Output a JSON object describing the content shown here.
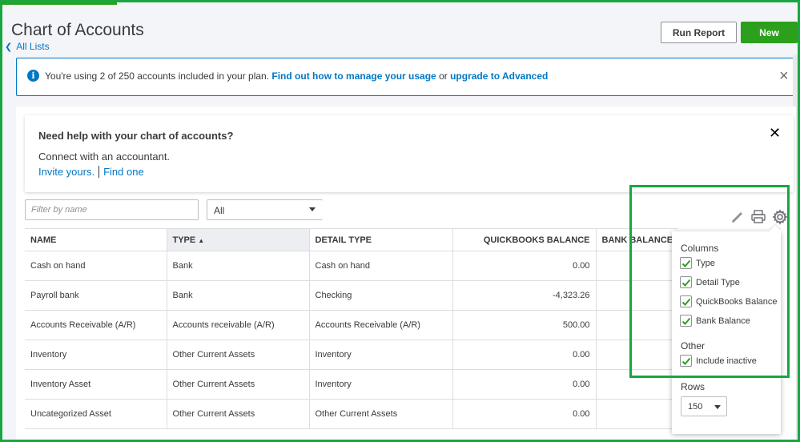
{
  "header": {
    "title": "Chart of Accounts",
    "back_link": "All Lists",
    "run_report_label": "Run Report",
    "new_label": "New"
  },
  "banner": {
    "text": "You're using 2 of 250 accounts included in your plan.",
    "link1": "Find out how to manage your usage",
    "joiner": "or",
    "link2": "upgrade to Advanced",
    "close_symbol": "×"
  },
  "help": {
    "title": "Need help with your chart of accounts?",
    "subtitle": "Connect with an accountant.",
    "link_invite": "Invite yours.",
    "link_find": "Find one",
    "close_symbol": "✕"
  },
  "filters": {
    "name_placeholder": "Filter by name",
    "type_value": "All"
  },
  "table": {
    "columns": {
      "name": "NAME",
      "type": "TYPE",
      "sort_indicator": "▲",
      "detail_type": "DETAIL TYPE",
      "qb_balance": "QUICKBOOKS BALANCE",
      "bank_balance": "BANK BALANCE"
    },
    "rows": [
      {
        "name": "Cash on hand",
        "type": "Bank",
        "detail": "Cash on hand",
        "qb": "0.00"
      },
      {
        "name": "Payroll bank",
        "type": "Bank",
        "detail": "Checking",
        "qb": "-4,323.26"
      },
      {
        "name": "Accounts Receivable (A/R)",
        "type": "Accounts receivable (A/R)",
        "detail": "Accounts Receivable (A/R)",
        "qb": "500.00"
      },
      {
        "name": "Inventory",
        "type": "Other Current Assets",
        "detail": "Inventory",
        "qb": "0.00"
      },
      {
        "name": "Inventory Asset",
        "type": "Other Current Assets",
        "detail": "Inventory",
        "qb": "0.00"
      },
      {
        "name": "Uncategorized Asset",
        "type": "Other Current Assets",
        "detail": "Other Current Assets",
        "qb": "0.00"
      }
    ]
  },
  "settings": {
    "columns_heading": "Columns",
    "columns": [
      {
        "label": "Type",
        "checked": true
      },
      {
        "label": "Detail Type",
        "checked": true
      },
      {
        "label": "QuickBooks Balance",
        "checked": true
      },
      {
        "label": "Bank Balance",
        "checked": true
      }
    ],
    "other_heading": "Other",
    "include_inactive": {
      "label": "Include inactive",
      "checked": true
    },
    "rows_heading": "Rows",
    "rows_value": "150"
  },
  "colors": {
    "accent_green": "#2ca01c",
    "link_blue": "#0077c5",
    "highlight_green": "#1aa543"
  }
}
